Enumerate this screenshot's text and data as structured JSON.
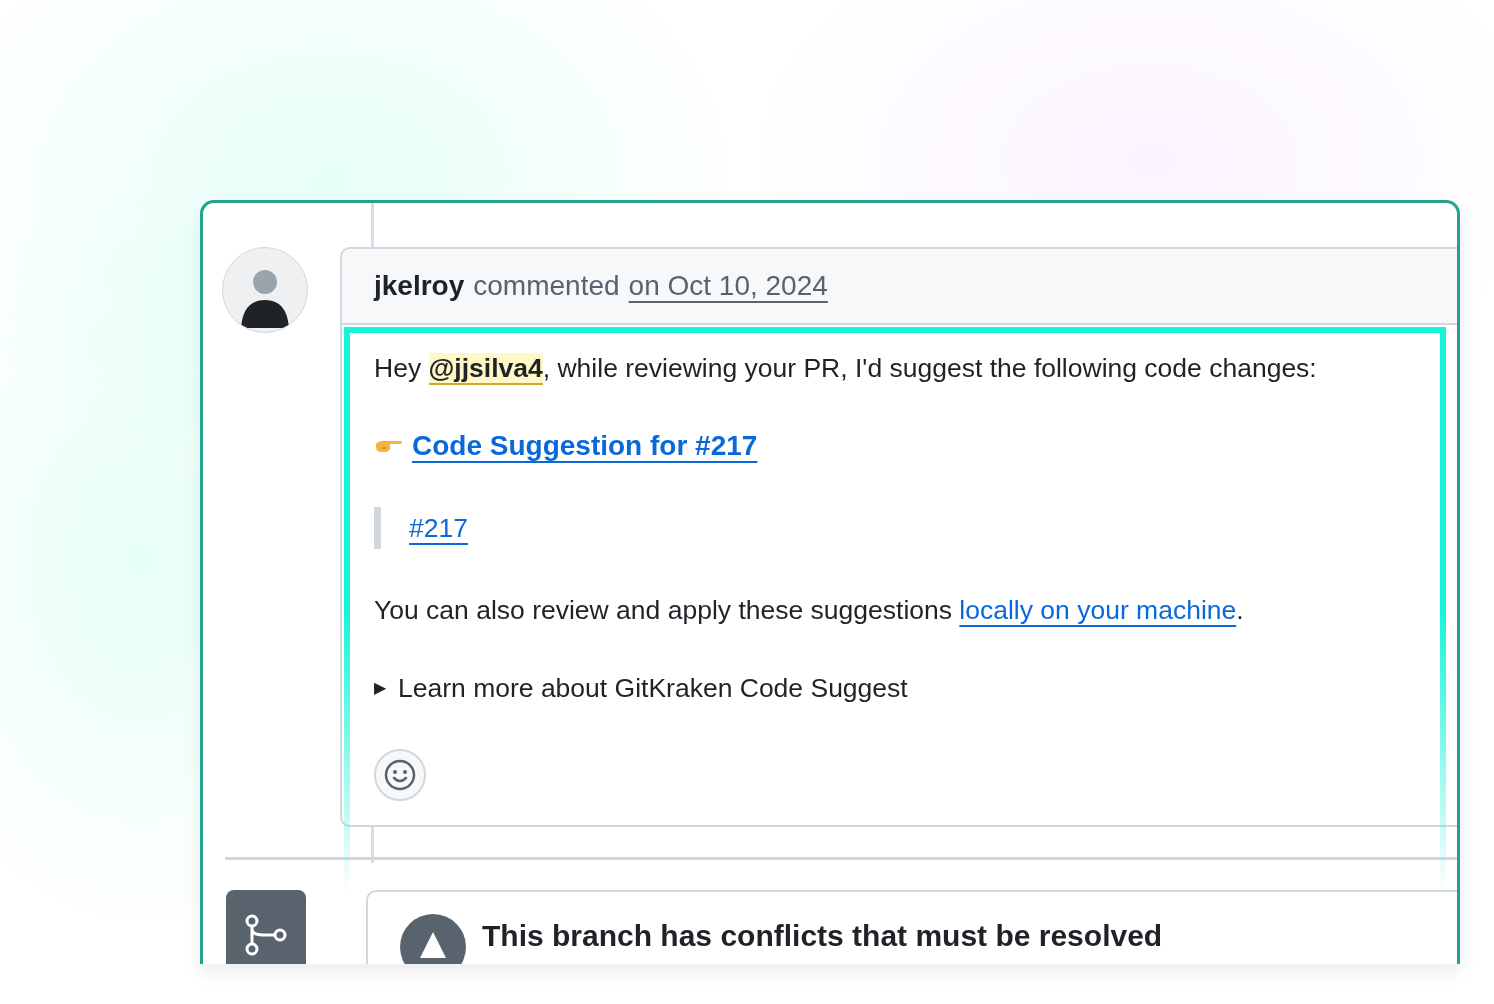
{
  "comment": {
    "author": "jkelroy",
    "action": "commented",
    "date": "on Oct 10, 2024",
    "greeting": {
      "before": "Hey",
      "mention": "@jjsilva4",
      "after": ", while reviewing your PR, I'd suggest the following code changes:"
    },
    "suggestion_link": "Code Suggestion for #217",
    "quote_link": "#217",
    "review_note": {
      "text": "You can also review and apply these suggestions",
      "link": "locally on your machine",
      "end": "."
    },
    "details": {
      "marker": "▶",
      "summary": "Learn more about GitKraken Code Suggest",
      "expanded": false
    }
  },
  "merge_status": {
    "title": "This branch has conflicts that must be resolved"
  }
}
